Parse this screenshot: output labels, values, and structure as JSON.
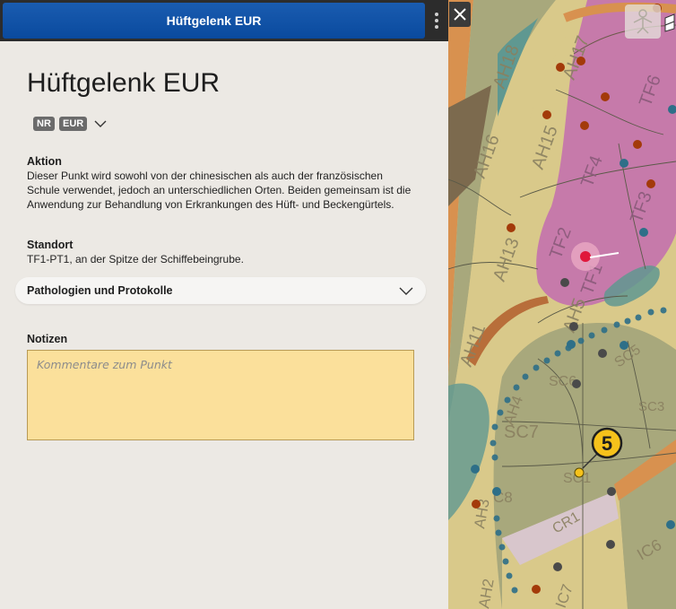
{
  "header": {
    "title": "Hüftgelenk EUR",
    "more_icon": "vertical-dots-icon"
  },
  "point": {
    "title": "Hüftgelenk EUR",
    "tags": [
      "NR",
      "EUR"
    ],
    "aktion_title": "Aktion",
    "aktion_text": "Dieser Punkt wird sowohl von der chinesischen als auch der französischen Schule verwendet, jedoch an unterschiedlichen Orten. Beiden gemeinsam ist die Anwendung zur Behandlung von Erkrankungen des Hüft- und Beckengürtels.",
    "standort_title": "Standort",
    "standort_text": "TF1-PT1, an der Spitze der Schiffebeingrube."
  },
  "pathologies": {
    "label": "Pathologien und Protokolle"
  },
  "notes": {
    "title": "Notizen",
    "placeholder": "Kommentare zum Punkt",
    "value": ""
  },
  "map": {
    "zones": [
      "AH18",
      "AH17",
      "TF6",
      "AH16",
      "AH15",
      "TF4",
      "TF3",
      "AH13",
      "TF2",
      "TF1",
      "AH11",
      "AH5",
      "SC5",
      "SC6",
      "AH4",
      "SC3",
      "SC7",
      "SC1",
      "AH3",
      "C8",
      "CR1",
      "IC6",
      "AH2",
      "IC7"
    ],
    "marker_number": "5",
    "colors": {
      "pink": "#c67aaa",
      "beige": "#d9c98a",
      "olive": "#a8a87c",
      "teal": "#5f9891",
      "orange": "#d8914f",
      "marker": "#f6c21b"
    }
  },
  "buttons": {
    "close_icon": "close-icon",
    "person_icon": "person-icon"
  }
}
